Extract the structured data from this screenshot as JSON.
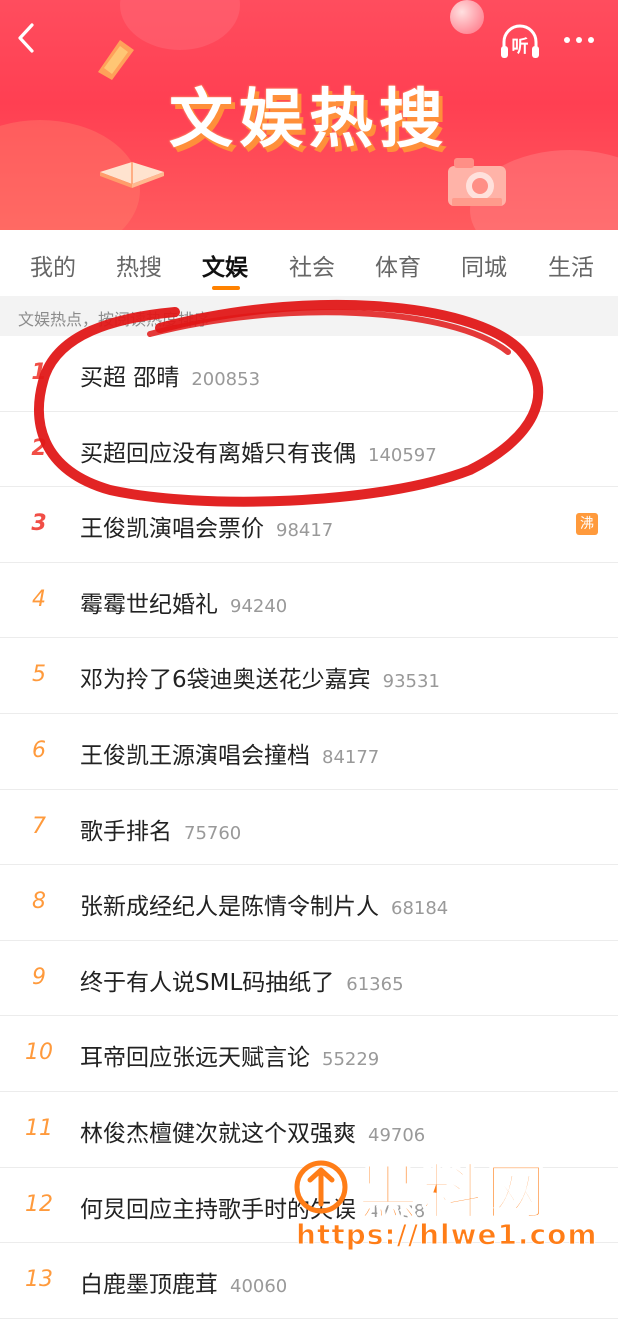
{
  "header": {
    "banner_title": "文娱热搜",
    "listen_label": "听"
  },
  "tabs": [
    {
      "label": "我的",
      "active": false
    },
    {
      "label": "热搜",
      "active": false
    },
    {
      "label": "文娱",
      "active": true
    },
    {
      "label": "社会",
      "active": false
    },
    {
      "label": "体育",
      "active": false
    },
    {
      "label": "同城",
      "active": false
    },
    {
      "label": "生活",
      "active": false
    }
  ],
  "subheader": {
    "text": "文娱热点，按阅读热度排序"
  },
  "list": [
    {
      "rank": "1",
      "title": "买超 邵晴",
      "count": "200853"
    },
    {
      "rank": "2",
      "title": "买超回应没有离婚只有丧偶",
      "count": "140597"
    },
    {
      "rank": "3",
      "title": "王俊凯演唱会票价",
      "count": "98417",
      "badge": "沸"
    },
    {
      "rank": "4",
      "title": "霉霉世纪婚礼",
      "count": "94240"
    },
    {
      "rank": "5",
      "title": "邓为拎了6袋迪奥送花少嘉宾",
      "count": "93531"
    },
    {
      "rank": "6",
      "title": "王俊凯王源演唱会撞档",
      "count": "84177"
    },
    {
      "rank": "7",
      "title": "歌手排名",
      "count": "75760"
    },
    {
      "rank": "8",
      "title": "张新成经纪人是陈情令制片人",
      "count": "68184"
    },
    {
      "rank": "9",
      "title": "终于有人说SML码抽纸了",
      "count": "61365"
    },
    {
      "rank": "10",
      "title": "耳帝回应张远天赋言论",
      "count": "55229"
    },
    {
      "rank": "11",
      "title": "林俊杰檀健次就这个双强爽",
      "count": "49706"
    },
    {
      "rank": "12",
      "title": "何炅回应主持歌手时的失误",
      "count": "47338"
    },
    {
      "rank": "13",
      "title": "白鹿墨顶鹿茸",
      "count": "40060"
    }
  ],
  "watermark": {
    "title": "黑料网",
    "url": "https://hlwe1.com"
  },
  "colors": {
    "accent": "#ff8200",
    "banner_red": "#ff4d5e",
    "rank_top": "#f14e46",
    "rank_other": "#ff9a3c",
    "annotation": "#e01818",
    "watermark": "#ff7d17"
  },
  "icons": {
    "back": "chevron-left-icon",
    "listen": "headphones-icon",
    "more": "more-dots-icon",
    "hot_badge": "hot-badge"
  }
}
